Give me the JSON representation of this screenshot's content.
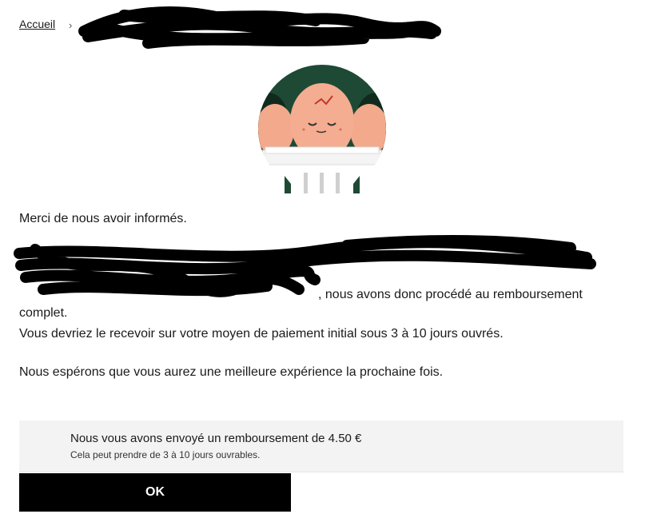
{
  "breadcrumb": {
    "home_label": "Accueil",
    "separator": "›"
  },
  "message": {
    "intro": "Merci de nous avoir informés.",
    "redacted_line_end": ", nous avons donc procédé au remboursement",
    "redacted_line_tail": "complet.",
    "delay": "Vous devriez le recevoir sur votre moyen de paiement initial sous 3 à 10 jours ouvrés.",
    "hope": "Nous espérons que vous aurez une meilleure expérience la prochaine fois."
  },
  "refund_banner": {
    "title": "Nous vous avons envoyé un remboursement de 4.50 €",
    "subtitle": "Cela peut prendre de 3 à 10 jours ouvrables."
  },
  "actions": {
    "ok_label": "OK"
  },
  "colors": {
    "illustration_bg": "#1e4a35",
    "egg": "#f2a98c",
    "button_bg": "#000000",
    "banner_bg": "#f3f3f3"
  },
  "icons": {
    "illustration": "sad-cracked-egg-illustration"
  }
}
